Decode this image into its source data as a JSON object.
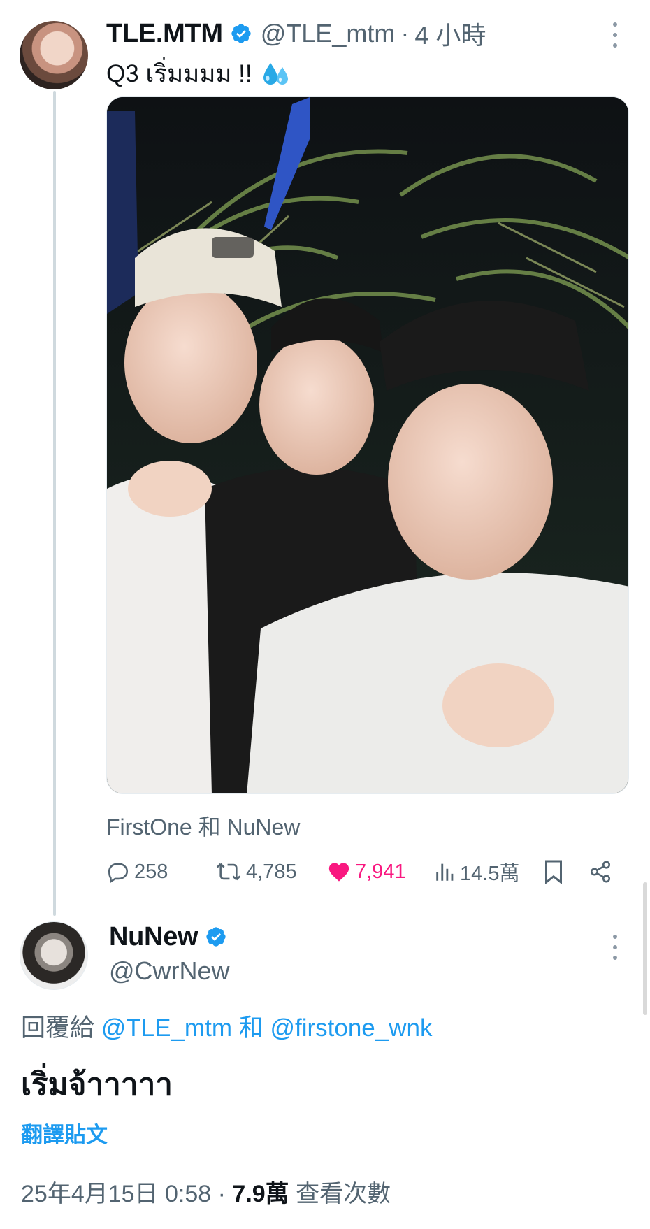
{
  "tweet": {
    "author_name": "TLE.MTM",
    "handle": "@TLE_mtm",
    "separator": "·",
    "time": "4 小時",
    "text": "Q3 เริ่มมมม !!",
    "emoji_icon": "sweat-droplets-icon",
    "photo_alt": "",
    "tagline": "FirstOne 和 NuNew",
    "actions": {
      "replies": "258",
      "retweets": "4,785",
      "likes": "7,941",
      "views": "14.5萬"
    }
  },
  "reply": {
    "author_name": "NuNew",
    "handle": "@CwrNew",
    "reply_to_prefix": "回覆給",
    "reply_to_mention_1": "@TLE_mtm",
    "reply_to_conj": "和",
    "reply_to_mention_2": "@firstone_wnk",
    "text": "เริ่มจ้าาาาา",
    "translate_label": "翻譯貼文",
    "date": "25年4月15日 0:58",
    "separator": "·",
    "views_count": "7.9萬",
    "views_label": "查看次數"
  },
  "colors": {
    "verified": "#1d9bf0",
    "like": "#f91880",
    "link": "#1d9bf0",
    "secondary": "#536471"
  }
}
